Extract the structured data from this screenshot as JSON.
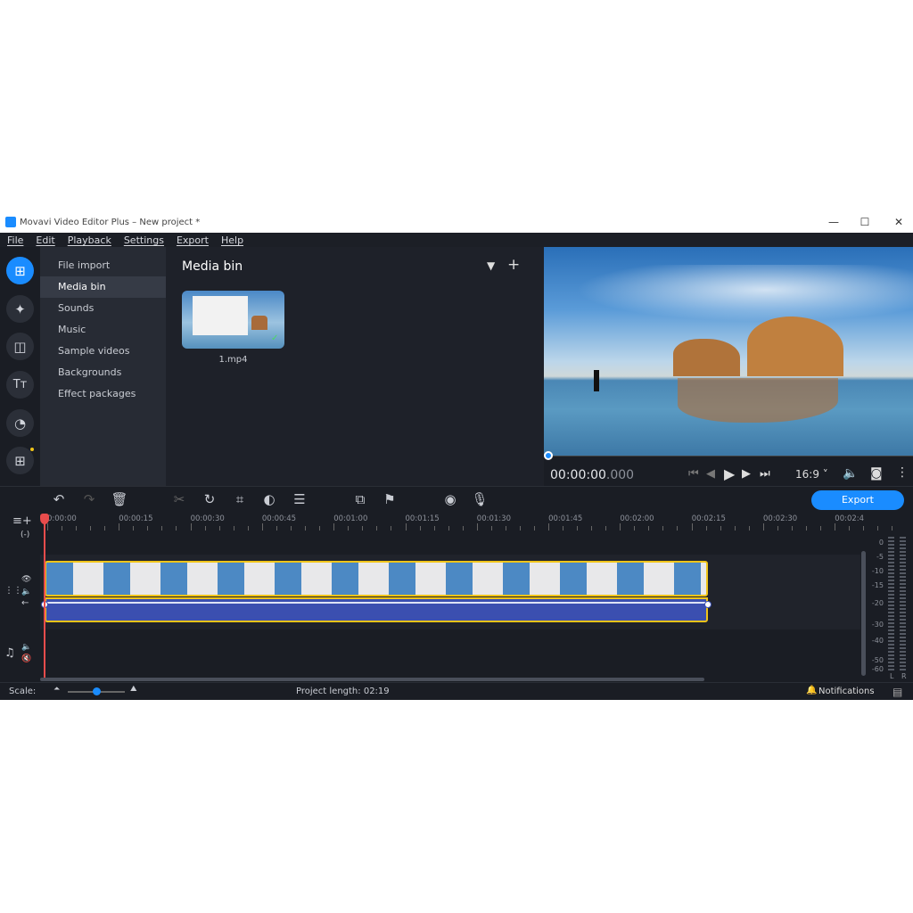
{
  "window": {
    "title": "Movavi Video Editor Plus – New project *",
    "minimize": "—",
    "maximize": "☐",
    "close": "✕"
  },
  "menu": [
    "File",
    "Edit",
    "Playback",
    "Settings",
    "Export",
    "Help"
  ],
  "nav": {
    "items": [
      "File import",
      "Media bin",
      "Sounds",
      "Music",
      "Sample videos",
      "Backgrounds",
      "Effect packages"
    ],
    "selected": "Media bin"
  },
  "bin": {
    "title": "Media bin",
    "files": [
      {
        "name": "1.mp4"
      }
    ]
  },
  "preview": {
    "timecode": "00:00:00",
    "timecode_ms": ".000",
    "aspect": "16:9",
    "progress": 0
  },
  "toolbar": {
    "export_label": "Export"
  },
  "ruler": {
    "ticks": [
      "0:00:00",
      "00:00:15",
      "00:00:30",
      "00:00:45",
      "00:01:00",
      "00:01:15",
      "00:01:30",
      "00:01:45",
      "00:02:00",
      "00:02:15",
      "00:02:30",
      "00:02:4"
    ]
  },
  "meter": {
    "labels": [
      "0",
      "-5",
      "-10",
      "-15",
      "-20",
      "-30",
      "-40",
      "-50",
      "-60"
    ],
    "channels": [
      "L",
      "R"
    ]
  },
  "bottom": {
    "scale_label": "Scale:",
    "project_length_label": "Project length:",
    "project_length": "02:19",
    "notifications": "Notifications"
  },
  "colors": {
    "accent": "#1a8cff",
    "clip_border": "#f0c419",
    "audio": "#3b4fb0",
    "playhead": "#e84c4c"
  }
}
